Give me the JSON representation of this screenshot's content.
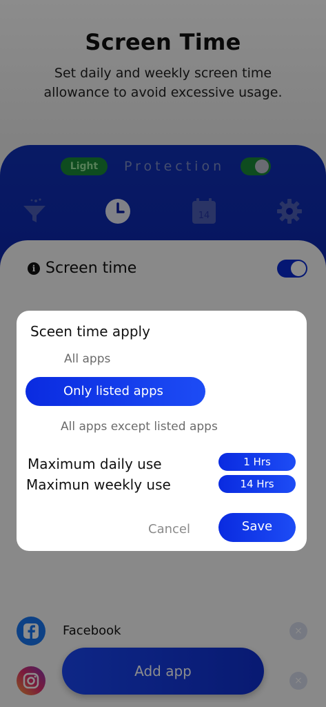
{
  "header": {
    "title": "Screen Time",
    "subtitle": "Set daily and weekly screen time allowance to avoid excessive usage."
  },
  "protection_bar": {
    "mode_badge": "Light",
    "label": "Protection",
    "toggle_on": true
  },
  "nav_icons": [
    {
      "name": "filter-icon"
    },
    {
      "name": "clock-icon"
    },
    {
      "name": "calendar-icon",
      "text": "14"
    },
    {
      "name": "gear-icon"
    }
  ],
  "screen_time": {
    "title": "Screen time",
    "enabled": true
  },
  "apps": [
    {
      "name": "Facebook",
      "icon": "facebook-icon"
    },
    {
      "name": "",
      "icon": "instagram-icon"
    }
  ],
  "add_app_label": "Add app",
  "dialog": {
    "title": "Sceen time apply",
    "options": [
      "All apps",
      "Only listed apps",
      "All apps except listed apps"
    ],
    "selected_option": "Only listed apps",
    "daily_label": "Maximum daily use",
    "daily_value": "1 Hrs",
    "weekly_label": "Maximun weekly use",
    "weekly_value": "14 Hrs",
    "cancel_label": "Cancel",
    "save_label": "Save"
  },
  "colors": {
    "accent": "#1a3ff0",
    "panel": "#0a1ea6",
    "toggle_green": "#1a8a3a"
  }
}
